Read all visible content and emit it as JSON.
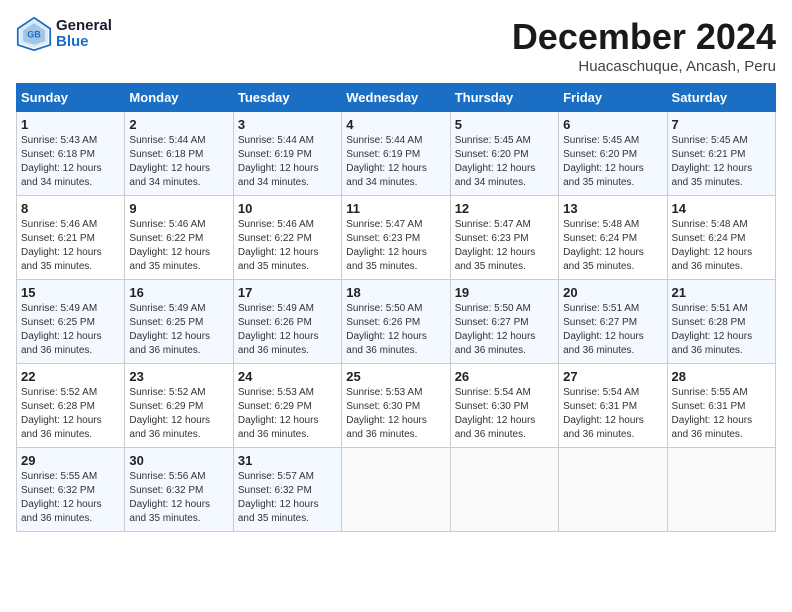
{
  "logo": {
    "line1": "General",
    "line2": "Blue"
  },
  "title": "December 2024",
  "location": "Huacaschuque, Ancash, Peru",
  "days_of_week": [
    "Sunday",
    "Monday",
    "Tuesday",
    "Wednesday",
    "Thursday",
    "Friday",
    "Saturday"
  ],
  "weeks": [
    [
      {
        "day": "1",
        "sunrise": "Sunrise: 5:43 AM",
        "sunset": "Sunset: 6:18 PM",
        "daylight": "Daylight: 12 hours and 34 minutes."
      },
      {
        "day": "2",
        "sunrise": "Sunrise: 5:44 AM",
        "sunset": "Sunset: 6:18 PM",
        "daylight": "Daylight: 12 hours and 34 minutes."
      },
      {
        "day": "3",
        "sunrise": "Sunrise: 5:44 AM",
        "sunset": "Sunset: 6:19 PM",
        "daylight": "Daylight: 12 hours and 34 minutes."
      },
      {
        "day": "4",
        "sunrise": "Sunrise: 5:44 AM",
        "sunset": "Sunset: 6:19 PM",
        "daylight": "Daylight: 12 hours and 34 minutes."
      },
      {
        "day": "5",
        "sunrise": "Sunrise: 5:45 AM",
        "sunset": "Sunset: 6:20 PM",
        "daylight": "Daylight: 12 hours and 34 minutes."
      },
      {
        "day": "6",
        "sunrise": "Sunrise: 5:45 AM",
        "sunset": "Sunset: 6:20 PM",
        "daylight": "Daylight: 12 hours and 35 minutes."
      },
      {
        "day": "7",
        "sunrise": "Sunrise: 5:45 AM",
        "sunset": "Sunset: 6:21 PM",
        "daylight": "Daylight: 12 hours and 35 minutes."
      }
    ],
    [
      {
        "day": "8",
        "sunrise": "Sunrise: 5:46 AM",
        "sunset": "Sunset: 6:21 PM",
        "daylight": "Daylight: 12 hours and 35 minutes."
      },
      {
        "day": "9",
        "sunrise": "Sunrise: 5:46 AM",
        "sunset": "Sunset: 6:22 PM",
        "daylight": "Daylight: 12 hours and 35 minutes."
      },
      {
        "day": "10",
        "sunrise": "Sunrise: 5:46 AM",
        "sunset": "Sunset: 6:22 PM",
        "daylight": "Daylight: 12 hours and 35 minutes."
      },
      {
        "day": "11",
        "sunrise": "Sunrise: 5:47 AM",
        "sunset": "Sunset: 6:23 PM",
        "daylight": "Daylight: 12 hours and 35 minutes."
      },
      {
        "day": "12",
        "sunrise": "Sunrise: 5:47 AM",
        "sunset": "Sunset: 6:23 PM",
        "daylight": "Daylight: 12 hours and 35 minutes."
      },
      {
        "day": "13",
        "sunrise": "Sunrise: 5:48 AM",
        "sunset": "Sunset: 6:24 PM",
        "daylight": "Daylight: 12 hours and 35 minutes."
      },
      {
        "day": "14",
        "sunrise": "Sunrise: 5:48 AM",
        "sunset": "Sunset: 6:24 PM",
        "daylight": "Daylight: 12 hours and 36 minutes."
      }
    ],
    [
      {
        "day": "15",
        "sunrise": "Sunrise: 5:49 AM",
        "sunset": "Sunset: 6:25 PM",
        "daylight": "Daylight: 12 hours and 36 minutes."
      },
      {
        "day": "16",
        "sunrise": "Sunrise: 5:49 AM",
        "sunset": "Sunset: 6:25 PM",
        "daylight": "Daylight: 12 hours and 36 minutes."
      },
      {
        "day": "17",
        "sunrise": "Sunrise: 5:49 AM",
        "sunset": "Sunset: 6:26 PM",
        "daylight": "Daylight: 12 hours and 36 minutes."
      },
      {
        "day": "18",
        "sunrise": "Sunrise: 5:50 AM",
        "sunset": "Sunset: 6:26 PM",
        "daylight": "Daylight: 12 hours and 36 minutes."
      },
      {
        "day": "19",
        "sunrise": "Sunrise: 5:50 AM",
        "sunset": "Sunset: 6:27 PM",
        "daylight": "Daylight: 12 hours and 36 minutes."
      },
      {
        "day": "20",
        "sunrise": "Sunrise: 5:51 AM",
        "sunset": "Sunset: 6:27 PM",
        "daylight": "Daylight: 12 hours and 36 minutes."
      },
      {
        "day": "21",
        "sunrise": "Sunrise: 5:51 AM",
        "sunset": "Sunset: 6:28 PM",
        "daylight": "Daylight: 12 hours and 36 minutes."
      }
    ],
    [
      {
        "day": "22",
        "sunrise": "Sunrise: 5:52 AM",
        "sunset": "Sunset: 6:28 PM",
        "daylight": "Daylight: 12 hours and 36 minutes."
      },
      {
        "day": "23",
        "sunrise": "Sunrise: 5:52 AM",
        "sunset": "Sunset: 6:29 PM",
        "daylight": "Daylight: 12 hours and 36 minutes."
      },
      {
        "day": "24",
        "sunrise": "Sunrise: 5:53 AM",
        "sunset": "Sunset: 6:29 PM",
        "daylight": "Daylight: 12 hours and 36 minutes."
      },
      {
        "day": "25",
        "sunrise": "Sunrise: 5:53 AM",
        "sunset": "Sunset: 6:30 PM",
        "daylight": "Daylight: 12 hours and 36 minutes."
      },
      {
        "day": "26",
        "sunrise": "Sunrise: 5:54 AM",
        "sunset": "Sunset: 6:30 PM",
        "daylight": "Daylight: 12 hours and 36 minutes."
      },
      {
        "day": "27",
        "sunrise": "Sunrise: 5:54 AM",
        "sunset": "Sunset: 6:31 PM",
        "daylight": "Daylight: 12 hours and 36 minutes."
      },
      {
        "day": "28",
        "sunrise": "Sunrise: 5:55 AM",
        "sunset": "Sunset: 6:31 PM",
        "daylight": "Daylight: 12 hours and 36 minutes."
      }
    ],
    [
      {
        "day": "29",
        "sunrise": "Sunrise: 5:55 AM",
        "sunset": "Sunset: 6:32 PM",
        "daylight": "Daylight: 12 hours and 36 minutes."
      },
      {
        "day": "30",
        "sunrise": "Sunrise: 5:56 AM",
        "sunset": "Sunset: 6:32 PM",
        "daylight": "Daylight: 12 hours and 35 minutes."
      },
      {
        "day": "31",
        "sunrise": "Sunrise: 5:57 AM",
        "sunset": "Sunset: 6:32 PM",
        "daylight": "Daylight: 12 hours and 35 minutes."
      },
      null,
      null,
      null,
      null
    ]
  ]
}
